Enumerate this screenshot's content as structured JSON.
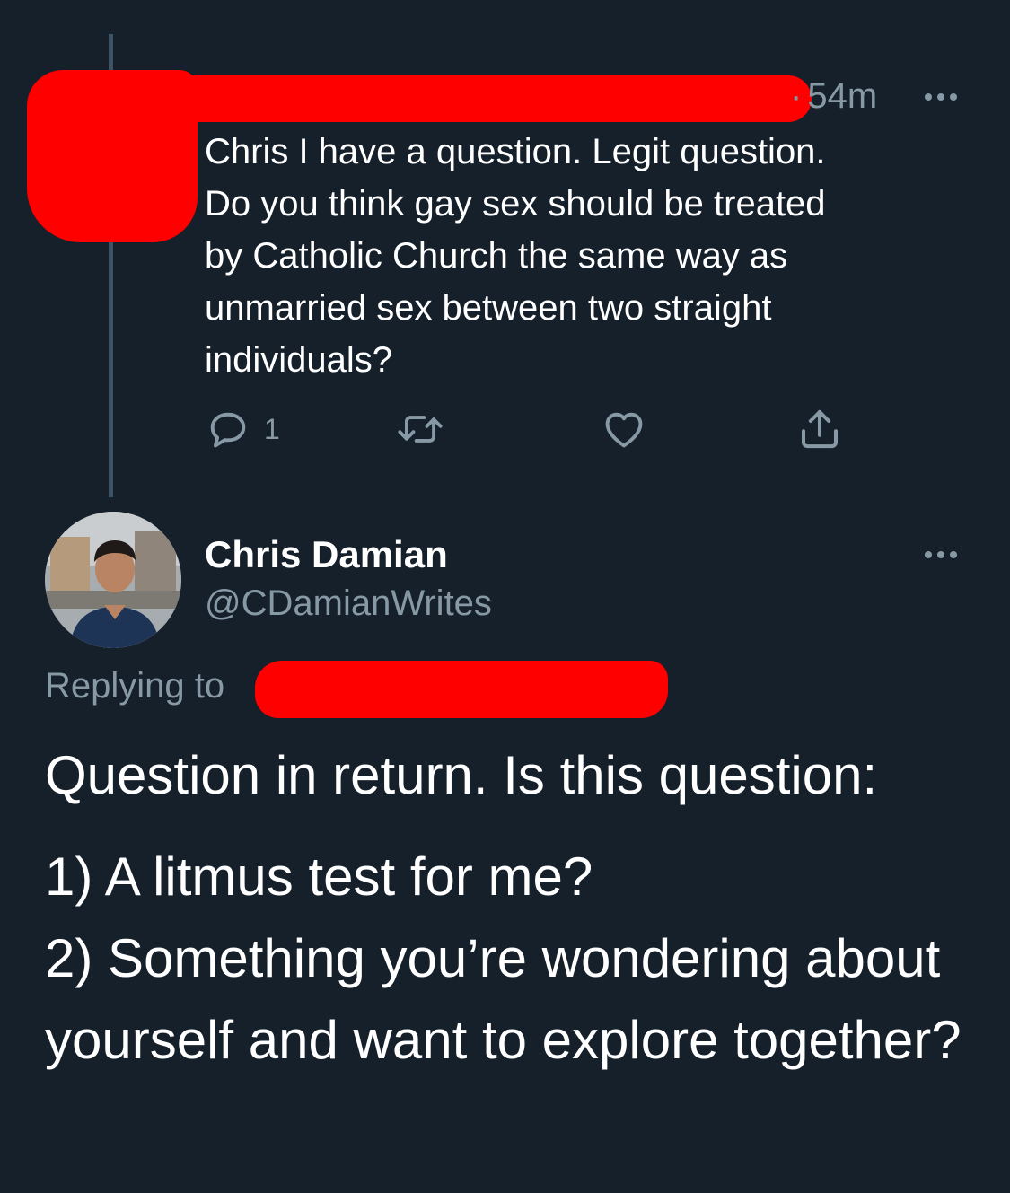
{
  "parent_tweet": {
    "time": "54m",
    "time_separator": "·",
    "text": "Chris I have a question. Legit question.\nDo you think gay sex should be treated\nby Catholic Church the same way as\nunmarried sex between two straight\nindividuals?",
    "reply_count": "1",
    "icons": {
      "reply": "reply-icon",
      "retweet": "retweet-icon",
      "like": "heart-icon",
      "share": "share-icon",
      "more": "more-icon"
    }
  },
  "reply_tweet": {
    "author_name": "Chris Damian",
    "author_handle": "@CDamianWrites",
    "replying_to_label": "Replying to",
    "question_line": "Question in return. Is this question:",
    "option_1": "1) A litmus test for me?",
    "option_2": "2) Something you’re wondering about yourself and want to explore together?"
  },
  "colors": {
    "background": "#15202b",
    "secondary_text": "#8899a6",
    "thread_line": "#3d5466",
    "redaction": "#ff0000"
  }
}
